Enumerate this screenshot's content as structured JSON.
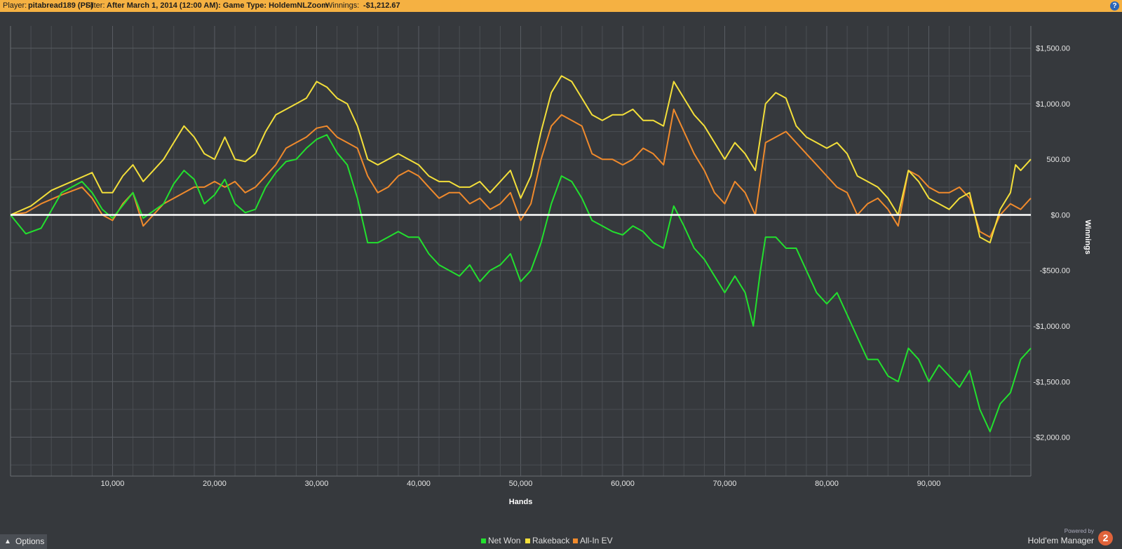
{
  "header": {
    "player_label": "Player:",
    "player": "pitabread189 (PS)",
    "filter_label": "Filter:",
    "filter": "After March 1, 2014 (12:00 AM): Game Type: HoldemNLZoom",
    "winnings_label": "Winnings:",
    "winnings": "-$1,212.67",
    "help_icon": "?"
  },
  "footer": {
    "options_label": "Options",
    "powered_by": "Powered by",
    "brand": "Hold'em Manager",
    "logo_text": "2"
  },
  "colors": {
    "background": "#36393d",
    "grid": "#4a4e53",
    "net_won": "#22e02e",
    "rakeback": "#f3df3a",
    "all_in_ev": "#f08a2c",
    "zero_line": "#ffffff",
    "header_bar": "#f5b142"
  },
  "chart_data": {
    "type": "line",
    "xlabel": "Hands",
    "ylabel": "Winnings",
    "xlim": [
      0,
      100000
    ],
    "ylim": [
      -2350,
      1700
    ],
    "x_ticks": [
      10000,
      20000,
      30000,
      40000,
      50000,
      60000,
      70000,
      80000,
      90000
    ],
    "x_tick_labels": [
      "10,000",
      "20,000",
      "30,000",
      "40,000",
      "50,000",
      "60,000",
      "70,000",
      "80,000",
      "90,000"
    ],
    "y_ticks": [
      1500,
      1000,
      500,
      0,
      -500,
      -1000,
      -1500,
      -2000
    ],
    "y_tick_labels": [
      "$1,500.00",
      "$1,000.00",
      "500.00",
      "$0.00",
      "-$500.00",
      "-$1,000.00",
      "-$1,500.00",
      "-$2,000.00"
    ],
    "grid": true,
    "legend_position": "bottom-center",
    "series": [
      {
        "name": "Net Won",
        "color": "#22e02e",
        "points": [
          [
            0,
            0
          ],
          [
            1500,
            -170
          ],
          [
            3000,
            -120
          ],
          [
            5000,
            200
          ],
          [
            7000,
            300
          ],
          [
            8000,
            200
          ],
          [
            9000,
            50
          ],
          [
            10000,
            -30
          ],
          [
            12000,
            200
          ],
          [
            13000,
            -30
          ],
          [
            15000,
            100
          ],
          [
            16000,
            280
          ],
          [
            17000,
            400
          ],
          [
            18000,
            320
          ],
          [
            19000,
            100
          ],
          [
            20000,
            180
          ],
          [
            21000,
            320
          ],
          [
            22000,
            100
          ],
          [
            23000,
            20
          ],
          [
            24000,
            50
          ],
          [
            25000,
            250
          ],
          [
            26000,
            380
          ],
          [
            27000,
            480
          ],
          [
            28000,
            500
          ],
          [
            29000,
            600
          ],
          [
            30000,
            680
          ],
          [
            31000,
            720
          ],
          [
            32000,
            560
          ],
          [
            33000,
            450
          ],
          [
            34000,
            150
          ],
          [
            35000,
            -250
          ],
          [
            36000,
            -250
          ],
          [
            37000,
            -200
          ],
          [
            38000,
            -150
          ],
          [
            39000,
            -200
          ],
          [
            40000,
            -200
          ],
          [
            41000,
            -350
          ],
          [
            42000,
            -450
          ],
          [
            43000,
            -500
          ],
          [
            44000,
            -550
          ],
          [
            45000,
            -450
          ],
          [
            46000,
            -600
          ],
          [
            47000,
            -500
          ],
          [
            48000,
            -450
          ],
          [
            49000,
            -350
          ],
          [
            50000,
            -600
          ],
          [
            51000,
            -500
          ],
          [
            52000,
            -250
          ],
          [
            53000,
            100
          ],
          [
            54000,
            350
          ],
          [
            55000,
            300
          ],
          [
            56000,
            150
          ],
          [
            57000,
            -50
          ],
          [
            58000,
            -100
          ],
          [
            59000,
            -150
          ],
          [
            60000,
            -180
          ],
          [
            61000,
            -100
          ],
          [
            62000,
            -150
          ],
          [
            63000,
            -250
          ],
          [
            64000,
            -300
          ],
          [
            65000,
            80
          ],
          [
            66000,
            -100
          ],
          [
            67000,
            -300
          ],
          [
            68000,
            -400
          ],
          [
            69000,
            -550
          ],
          [
            70000,
            -700
          ],
          [
            71000,
            -550
          ],
          [
            72000,
            -700
          ],
          [
            72800,
            -1000
          ],
          [
            73500,
            -500
          ],
          [
            74000,
            -200
          ],
          [
            75000,
            -200
          ],
          [
            76000,
            -300
          ],
          [
            77000,
            -300
          ],
          [
            78000,
            -500
          ],
          [
            79000,
            -700
          ],
          [
            80000,
            -800
          ],
          [
            81000,
            -700
          ],
          [
            82000,
            -900
          ],
          [
            83000,
            -1100
          ],
          [
            84000,
            -1300
          ],
          [
            85000,
            -1300
          ],
          [
            86000,
            -1450
          ],
          [
            87000,
            -1500
          ],
          [
            88000,
            -1200
          ],
          [
            89000,
            -1300
          ],
          [
            90000,
            -1500
          ],
          [
            91000,
            -1350
          ],
          [
            92000,
            -1450
          ],
          [
            93000,
            -1550
          ],
          [
            94000,
            -1400
          ],
          [
            95000,
            -1750
          ],
          [
            96000,
            -1950
          ],
          [
            97000,
            -1700
          ],
          [
            98000,
            -1600
          ],
          [
            99000,
            -1300
          ],
          [
            100000,
            -1200
          ]
        ]
      },
      {
        "name": "Rakeback",
        "color": "#f3df3a",
        "points": [
          [
            0,
            0
          ],
          [
            2000,
            80
          ],
          [
            4000,
            220
          ],
          [
            6000,
            300
          ],
          [
            8000,
            380
          ],
          [
            9000,
            200
          ],
          [
            10000,
            200
          ],
          [
            11000,
            350
          ],
          [
            12000,
            450
          ],
          [
            13000,
            300
          ],
          [
            15000,
            500
          ],
          [
            16000,
            650
          ],
          [
            17000,
            800
          ],
          [
            18000,
            700
          ],
          [
            19000,
            550
          ],
          [
            20000,
            500
          ],
          [
            21000,
            700
          ],
          [
            22000,
            500
          ],
          [
            23000,
            480
          ],
          [
            24000,
            550
          ],
          [
            25000,
            750
          ],
          [
            26000,
            900
          ],
          [
            27000,
            950
          ],
          [
            28000,
            1000
          ],
          [
            29000,
            1050
          ],
          [
            30000,
            1200
          ],
          [
            31000,
            1150
          ],
          [
            32000,
            1050
          ],
          [
            33000,
            1000
          ],
          [
            34000,
            800
          ],
          [
            35000,
            500
          ],
          [
            36000,
            450
          ],
          [
            37000,
            500
          ],
          [
            38000,
            550
          ],
          [
            39000,
            500
          ],
          [
            40000,
            450
          ],
          [
            41000,
            350
          ],
          [
            42000,
            300
          ],
          [
            43000,
            300
          ],
          [
            44000,
            250
          ],
          [
            45000,
            250
          ],
          [
            46000,
            300
          ],
          [
            47000,
            200
          ],
          [
            48000,
            300
          ],
          [
            49000,
            400
          ],
          [
            50000,
            150
          ],
          [
            51000,
            350
          ],
          [
            52000,
            750
          ],
          [
            53000,
            1100
          ],
          [
            54000,
            1250
          ],
          [
            55000,
            1200
          ],
          [
            56000,
            1050
          ],
          [
            57000,
            900
          ],
          [
            58000,
            850
          ],
          [
            59000,
            900
          ],
          [
            60000,
            900
          ],
          [
            61000,
            950
          ],
          [
            62000,
            850
          ],
          [
            63000,
            850
          ],
          [
            64000,
            800
          ],
          [
            65000,
            1200
          ],
          [
            66000,
            1050
          ],
          [
            67000,
            900
          ],
          [
            68000,
            800
          ],
          [
            69000,
            650
          ],
          [
            70000,
            500
          ],
          [
            71000,
            650
          ],
          [
            72000,
            550
          ],
          [
            73000,
            400
          ],
          [
            74000,
            1000
          ],
          [
            75000,
            1100
          ],
          [
            76000,
            1050
          ],
          [
            77000,
            800
          ],
          [
            78000,
            700
          ],
          [
            79000,
            650
          ],
          [
            80000,
            600
          ],
          [
            81000,
            650
          ],
          [
            82000,
            550
          ],
          [
            83000,
            350
          ],
          [
            84000,
            300
          ],
          [
            85000,
            250
          ],
          [
            86000,
            150
          ],
          [
            87000,
            0
          ],
          [
            88000,
            400
          ],
          [
            89000,
            300
          ],
          [
            90000,
            150
          ],
          [
            91000,
            100
          ],
          [
            92000,
            50
          ],
          [
            93000,
            150
          ],
          [
            94000,
            200
          ],
          [
            95000,
            -200
          ],
          [
            96000,
            -250
          ],
          [
            97000,
            50
          ],
          [
            98000,
            200
          ],
          [
            98500,
            450
          ],
          [
            99000,
            400
          ],
          [
            100000,
            500
          ]
        ]
      },
      {
        "name": "All-In EV",
        "color": "#f08a2c",
        "points": [
          [
            0,
            0
          ],
          [
            1500,
            20
          ],
          [
            3000,
            100
          ],
          [
            5000,
            180
          ],
          [
            7000,
            250
          ],
          [
            8000,
            150
          ],
          [
            9000,
            0
          ],
          [
            10000,
            -50
          ],
          [
            11000,
            100
          ],
          [
            12000,
            200
          ],
          [
            13000,
            -100
          ],
          [
            14000,
            0
          ],
          [
            15000,
            100
          ],
          [
            16000,
            150
          ],
          [
            17000,
            200
          ],
          [
            18000,
            250
          ],
          [
            19000,
            250
          ],
          [
            20000,
            300
          ],
          [
            21000,
            250
          ],
          [
            22000,
            300
          ],
          [
            23000,
            200
          ],
          [
            24000,
            250
          ],
          [
            25000,
            350
          ],
          [
            26000,
            450
          ],
          [
            27000,
            600
          ],
          [
            28000,
            650
          ],
          [
            29000,
            700
          ],
          [
            30000,
            780
          ],
          [
            31000,
            800
          ],
          [
            32000,
            700
          ],
          [
            33000,
            650
          ],
          [
            34000,
            600
          ],
          [
            35000,
            350
          ],
          [
            36000,
            200
          ],
          [
            37000,
            250
          ],
          [
            38000,
            350
          ],
          [
            39000,
            400
          ],
          [
            40000,
            350
          ],
          [
            41000,
            250
          ],
          [
            42000,
            150
          ],
          [
            43000,
            200
          ],
          [
            44000,
            200
          ],
          [
            45000,
            100
          ],
          [
            46000,
            150
          ],
          [
            47000,
            50
          ],
          [
            48000,
            100
          ],
          [
            49000,
            200
          ],
          [
            50000,
            -50
          ],
          [
            51000,
            100
          ],
          [
            52000,
            500
          ],
          [
            53000,
            800
          ],
          [
            54000,
            900
          ],
          [
            55000,
            850
          ],
          [
            56000,
            800
          ],
          [
            57000,
            550
          ],
          [
            58000,
            500
          ],
          [
            59000,
            500
          ],
          [
            60000,
            450
          ],
          [
            61000,
            500
          ],
          [
            62000,
            600
          ],
          [
            63000,
            550
          ],
          [
            64000,
            450
          ],
          [
            65000,
            950
          ],
          [
            66000,
            750
          ],
          [
            67000,
            550
          ],
          [
            68000,
            400
          ],
          [
            69000,
            200
          ],
          [
            70000,
            100
          ],
          [
            71000,
            300
          ],
          [
            72000,
            200
          ],
          [
            73000,
            0
          ],
          [
            74000,
            650
          ],
          [
            75000,
            700
          ],
          [
            76000,
            750
          ],
          [
            77000,
            650
          ],
          [
            78000,
            550
          ],
          [
            79000,
            450
          ],
          [
            80000,
            350
          ],
          [
            81000,
            250
          ],
          [
            82000,
            200
          ],
          [
            83000,
            0
          ],
          [
            84000,
            100
          ],
          [
            85000,
            150
          ],
          [
            86000,
            50
          ],
          [
            87000,
            -100
          ],
          [
            88000,
            400
          ],
          [
            89000,
            350
          ],
          [
            90000,
            250
          ],
          [
            91000,
            200
          ],
          [
            92000,
            200
          ],
          [
            93000,
            250
          ],
          [
            94000,
            150
          ],
          [
            95000,
            -150
          ],
          [
            96000,
            -200
          ],
          [
            97000,
            0
          ],
          [
            98000,
            100
          ],
          [
            99000,
            50
          ],
          [
            100000,
            150
          ]
        ]
      }
    ]
  }
}
